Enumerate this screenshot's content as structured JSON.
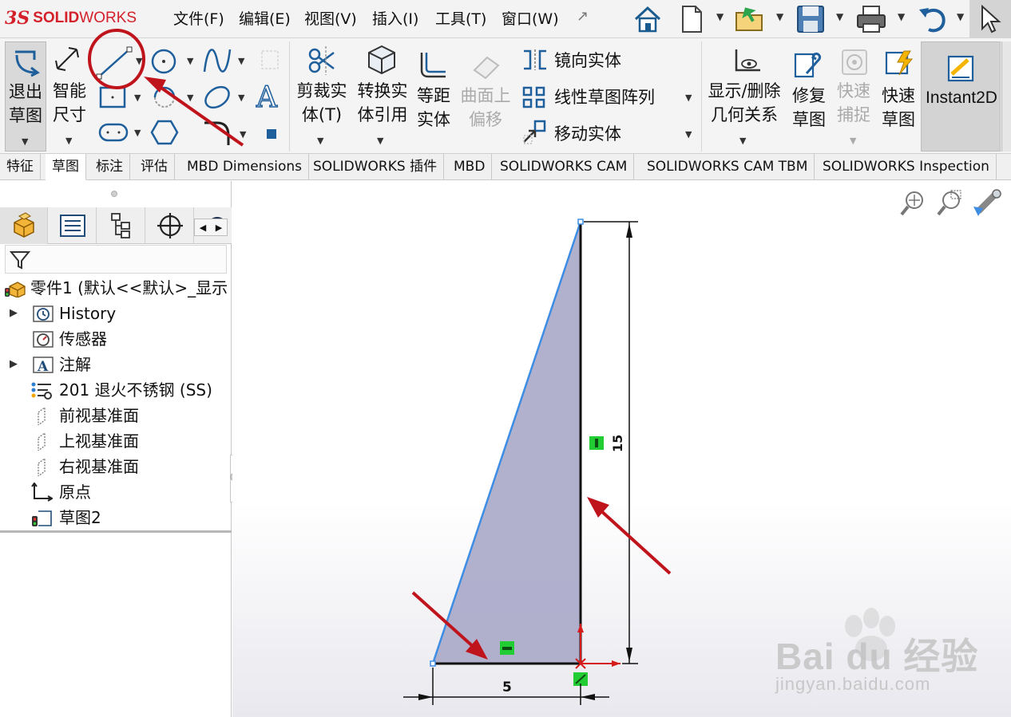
{
  "app": {
    "logo_ds": "3S",
    "logo_brand_bold": "SOLID",
    "logo_brand_rest": "WORKS"
  },
  "menu": {
    "items": [
      "文件(F)",
      "编辑(E)",
      "视图(V)",
      "插入(I)",
      "工具(T)",
      "窗口(W)"
    ]
  },
  "quick_access": {
    "icons": [
      "home-icon",
      "new-document-icon",
      "open-icon",
      "save-icon",
      "print-icon",
      "undo-icon",
      "select-cursor-icon"
    ]
  },
  "ribbon": {
    "exit_sketch": [
      "退出",
      "草图"
    ],
    "smart_dim": [
      "智能",
      "尺寸"
    ],
    "trim": [
      "剪裁实",
      "体(T)"
    ],
    "convert": [
      "转换实",
      "体引用"
    ],
    "offset": [
      "等距",
      "实体"
    ],
    "surface_offset": [
      "曲面上",
      "偏移"
    ],
    "mirror": "镜向实体",
    "linear_pattern": "线性草图阵列",
    "move": "移动实体",
    "relations": [
      "显示/删除",
      "几何关系"
    ],
    "repair": [
      "修复",
      "草图"
    ],
    "quick_snap": [
      "快速",
      "捕捉"
    ],
    "rapid_sketch": [
      "快速",
      "草图"
    ],
    "instant2d": "Instant2D"
  },
  "tabs": [
    "特征",
    "草图",
    "标注",
    "评估",
    "MBD Dimensions",
    "SOLIDWORKS 插件",
    "MBD",
    "SOLIDWORKS CAM",
    "SOLIDWORKS CAM TBM",
    "SOLIDWORKS Inspection"
  ],
  "active_tab": "草图",
  "tree": {
    "root": "零件1  (默认<<默认>_显示",
    "items": [
      {
        "label": "History",
        "expandable": true
      },
      {
        "label": "传感器",
        "expandable": false
      },
      {
        "label": "注解",
        "expandable": true
      },
      {
        "label": "201 退火不锈钢 (SS)",
        "expandable": false
      },
      {
        "label": "前视基准面",
        "expandable": false
      },
      {
        "label": "上视基准面",
        "expandable": false
      },
      {
        "label": "右视基准面",
        "expandable": false
      },
      {
        "label": "原点",
        "expandable": false
      },
      {
        "label": "草图2",
        "expandable": false
      }
    ]
  },
  "sketch": {
    "dim_vertical": "15",
    "dim_horizontal": "5"
  },
  "watermark": {
    "text": "Bai du 经验",
    "url": "jingyan.baidu.com"
  },
  "colors": {
    "accent_red": "#c0141c",
    "sketch_fill": "#a9a9c9",
    "sketch_blue": "#3d8de4",
    "relation_green": "#22cc33"
  }
}
